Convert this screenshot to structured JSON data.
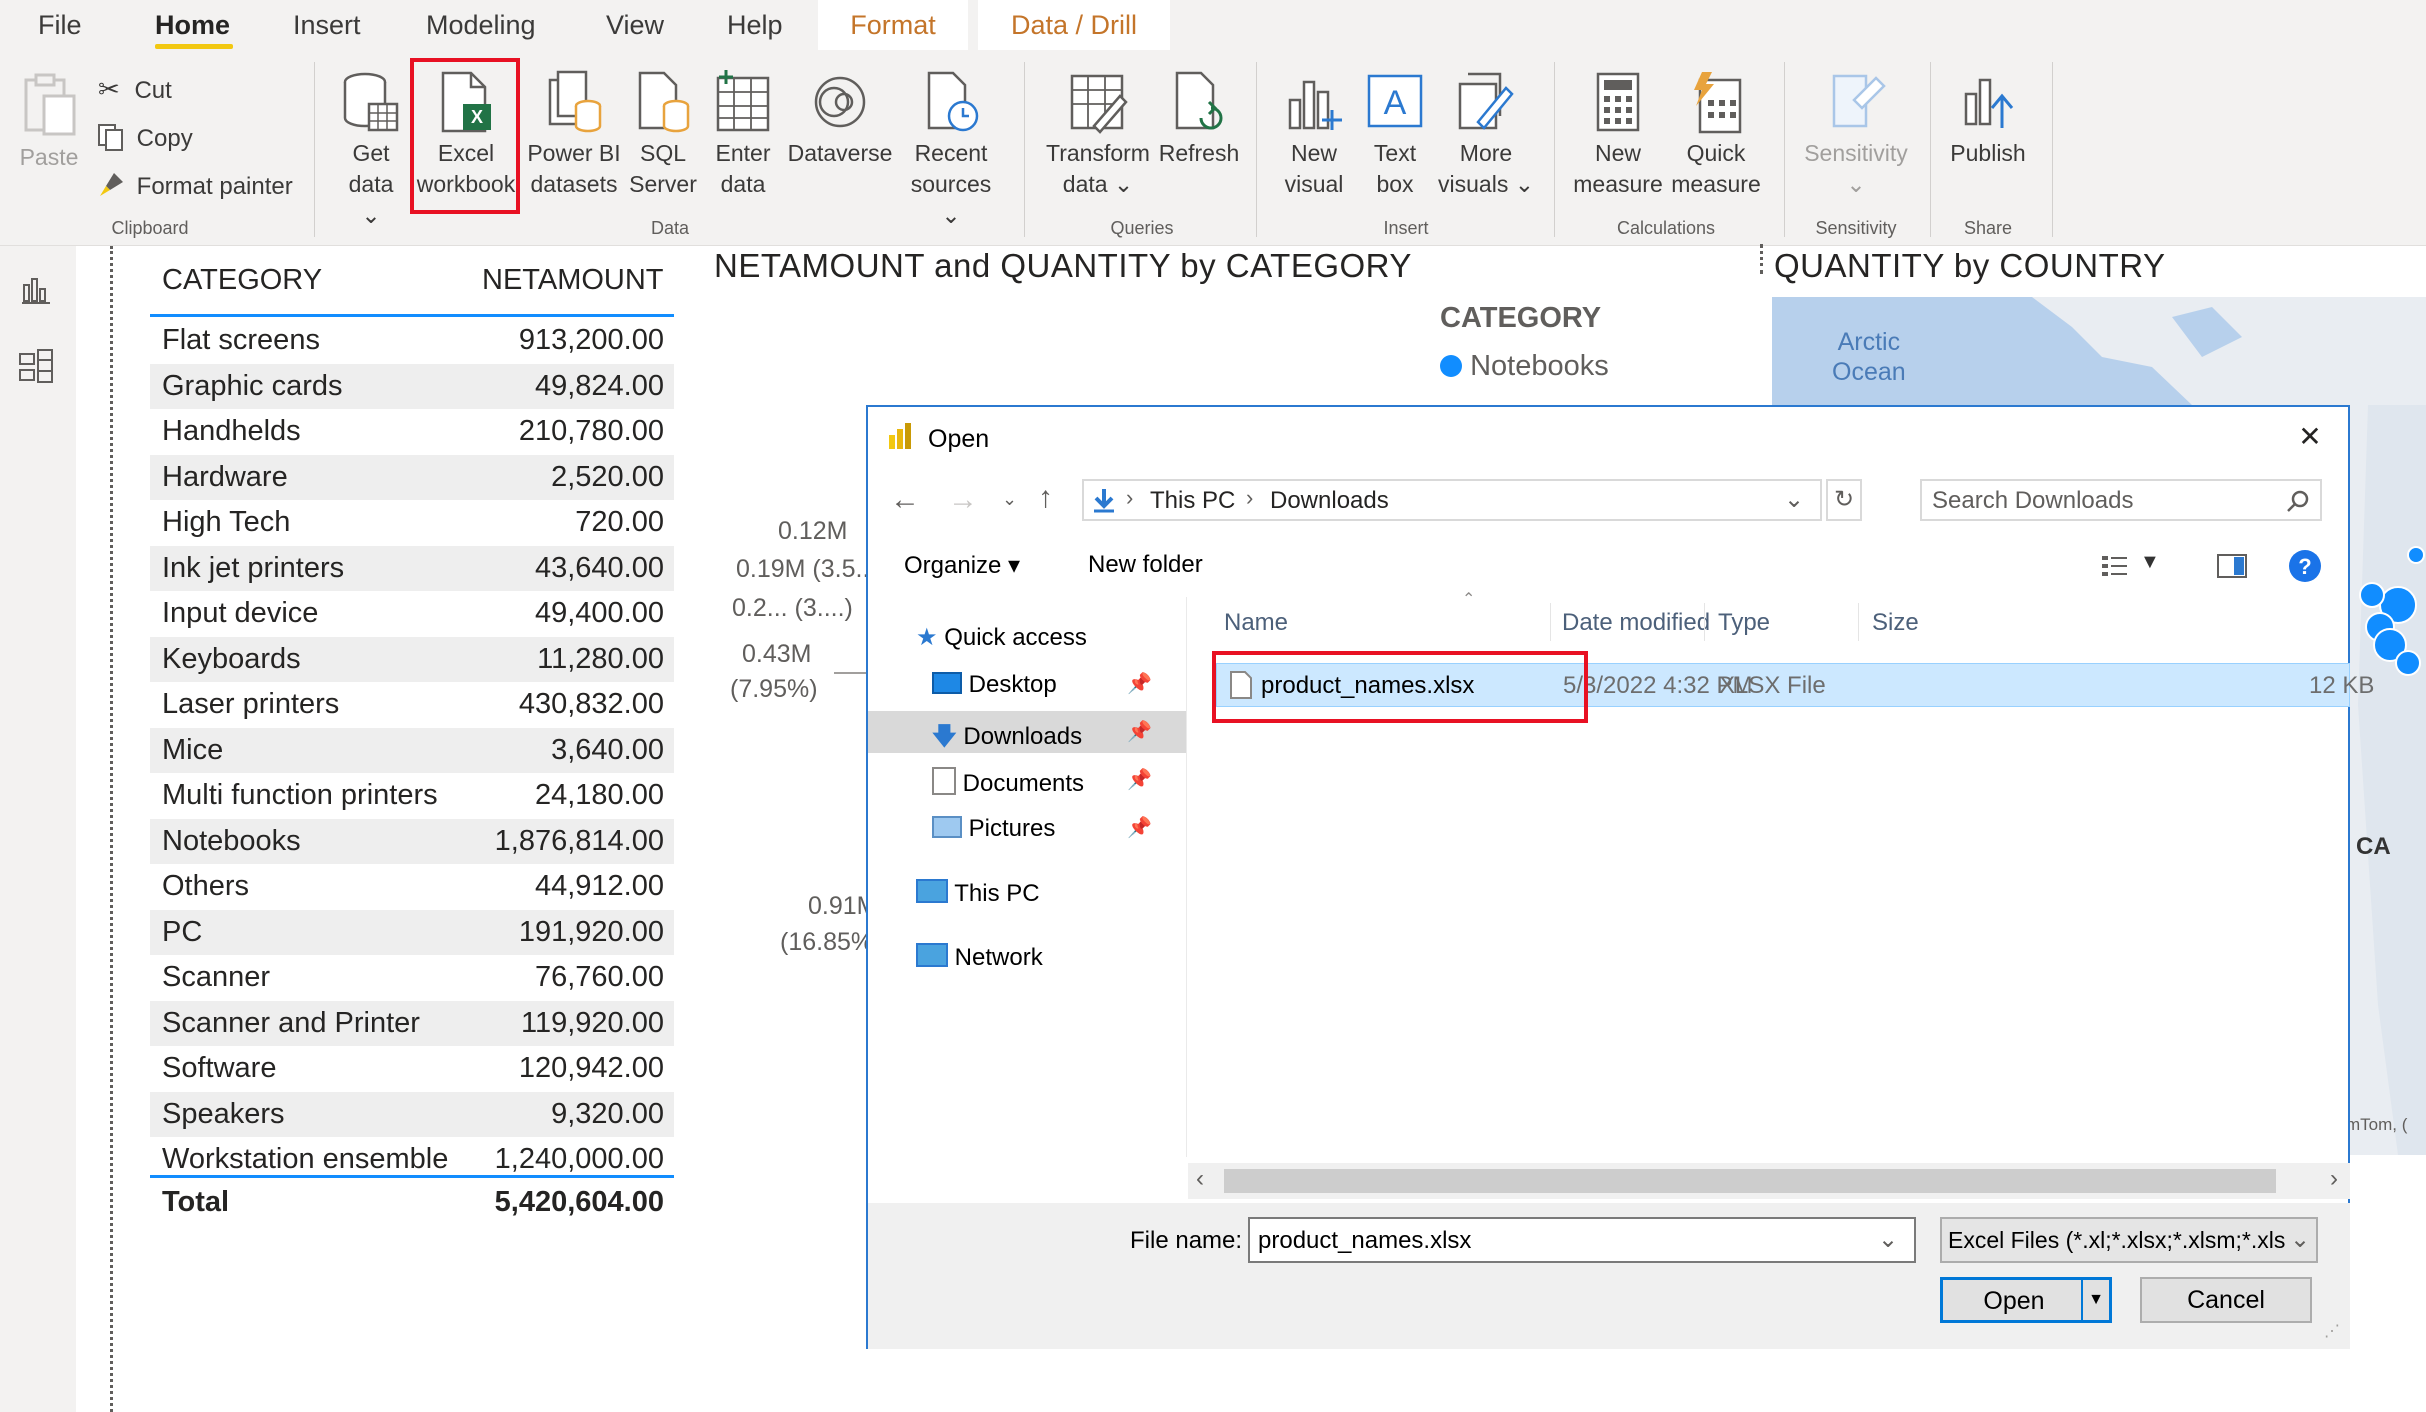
{
  "menu": {
    "file": "File",
    "home": "Home",
    "insert": "Insert",
    "modeling": "Modeling",
    "view": "View",
    "help": "Help",
    "format": "Format",
    "data_drill": "Data / Drill"
  },
  "ribbon": {
    "clipboard": {
      "paste": "Paste",
      "cut": "Cut",
      "copy": "Copy",
      "format_painter": "Format painter",
      "label": "Clipboard"
    },
    "data": {
      "get_data": [
        "Get",
        "data ⌄"
      ],
      "excel": [
        "Excel",
        "workbook"
      ],
      "powerbi": [
        "Power BI",
        "datasets"
      ],
      "sql": [
        "SQL",
        "Server"
      ],
      "enter": [
        "Enter",
        "data"
      ],
      "dataverse": [
        "Dataverse"
      ],
      "recent": [
        "Recent",
        "sources ⌄"
      ],
      "label": "Data"
    },
    "queries": {
      "transform": [
        "Transform",
        "data ⌄"
      ],
      "refresh": [
        "Refresh"
      ],
      "label": "Queries"
    },
    "insert": {
      "new_visual": [
        "New",
        "visual"
      ],
      "text_box": [
        "Text",
        "box"
      ],
      "more_visuals": [
        "More",
        "visuals ⌄"
      ],
      "label": "Insert"
    },
    "calculations": {
      "new_measure": [
        "New",
        "measure"
      ],
      "quick_measure": [
        "Quick",
        "measure"
      ],
      "label": "Calculations"
    },
    "sensitivity": {
      "btn": [
        "Sensitivity",
        "⌄"
      ],
      "label": "Sensitivity"
    },
    "share": {
      "publish": [
        "Publish"
      ],
      "label": "Share"
    }
  },
  "table": {
    "headers": [
      "CATEGORY",
      "NETAMOUNT"
    ],
    "rows": [
      [
        "Flat screens",
        "913,200.00"
      ],
      [
        "Graphic cards",
        "49,824.00"
      ],
      [
        "Handhelds",
        "210,780.00"
      ],
      [
        "Hardware",
        "2,520.00"
      ],
      [
        "High Tech",
        "720.00"
      ],
      [
        "Ink jet printers",
        "43,640.00"
      ],
      [
        "Input device",
        "49,400.00"
      ],
      [
        "Keyboards",
        "11,280.00"
      ],
      [
        "Laser printers",
        "430,832.00"
      ],
      [
        "Mice",
        "3,640.00"
      ],
      [
        "Multi function printers",
        "24,180.00"
      ],
      [
        "Notebooks",
        "1,876,814.00"
      ],
      [
        "Others",
        "44,912.00"
      ],
      [
        "PC",
        "191,920.00"
      ],
      [
        "Scanner",
        "76,760.00"
      ],
      [
        "Scanner and Printer",
        "119,920.00"
      ],
      [
        "Software",
        "120,942.00"
      ],
      [
        "Speakers",
        "9,320.00"
      ],
      [
        "Workstation ensemble",
        "1,240,000.00"
      ]
    ],
    "total_label": "Total",
    "total_value": "5,420,604.00"
  },
  "chart": {
    "title": "NETAMOUNT and QUANTITY by CATEGORY",
    "legend_title": "CATEGORY",
    "legend_item": "Notebooks",
    "labels": [
      "0.12M",
      "0.19M (3.5...",
      "0.2... (3....)",
      "0.43M",
      "(7.95%)",
      "0.91M",
      "(16.85%"
    ]
  },
  "map": {
    "title": "QUANTITY by COUNTRY",
    "ocean_1": "Arctic",
    "ocean_2": "Ocean",
    "region": "CA",
    "credit": "mTom, ("
  },
  "dialog": {
    "title": "Open",
    "close": "✕",
    "path": [
      "This PC",
      "Downloads"
    ],
    "search_placeholder": "Search Downloads",
    "organize": "Organize ▾",
    "new_folder": "New folder",
    "nav": {
      "quick_access": "Quick access",
      "desktop": "Desktop",
      "downloads": "Downloads",
      "documents": "Documents",
      "pictures": "Pictures",
      "this_pc": "This PC",
      "network": "Network"
    },
    "columns": [
      "Name",
      "Date modified",
      "Type",
      "Size"
    ],
    "file": {
      "name": "product_names.xlsx",
      "date": "5/3/2022 4:32 PM",
      "type": "XLSX File",
      "size": "12 KB"
    },
    "file_name_label": "File name:",
    "file_name_value": "product_names.xlsx",
    "filter": "Excel Files (*.xl;*.xlsx;*.xlsm;*.xls",
    "open_btn": "Open",
    "cancel_btn": "Cancel"
  },
  "colors": {
    "accent_yellow": "#f2c811",
    "highlight_red": "#e81123",
    "selection_blue": "#cce8ff",
    "dialog_border": "#2b79d0",
    "legend_dot": "#118dff"
  }
}
